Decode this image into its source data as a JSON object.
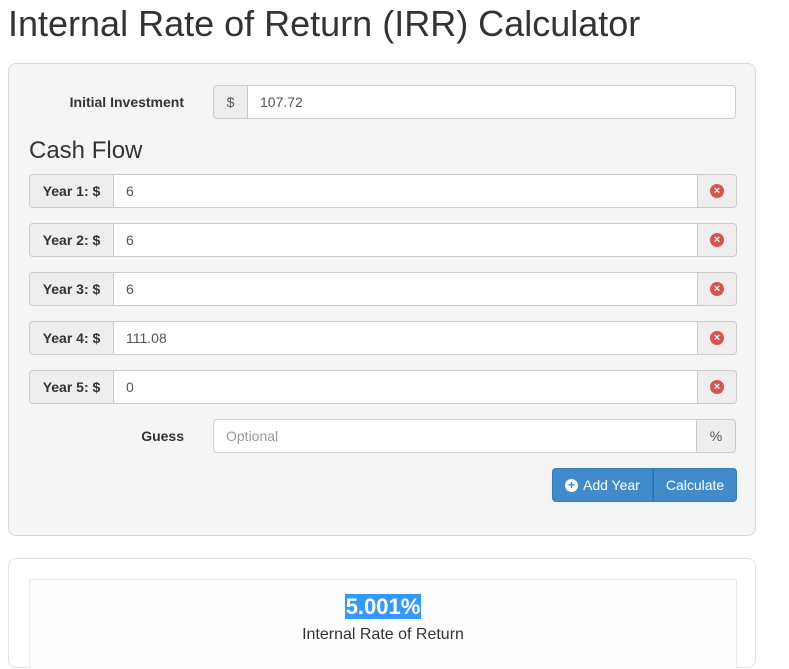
{
  "page": {
    "title": "Internal Rate of Return (IRR) Calculator"
  },
  "form": {
    "initial_investment": {
      "label": "Initial Investment",
      "prefix": "$",
      "value": "107.72"
    },
    "cash_flow_heading": "Cash Flow",
    "cash_flows": [
      {
        "label": "Year 1: $",
        "value": "6"
      },
      {
        "label": "Year 2: $",
        "value": "6"
      },
      {
        "label": "Year 3: $",
        "value": "6"
      },
      {
        "label": "Year 4: $",
        "value": "111.08"
      },
      {
        "label": "Year 5: $",
        "value": "0"
      }
    ],
    "remove_icon_name": "remove-circle-icon",
    "remove_icon_glyph": "×",
    "guess": {
      "label": "Guess",
      "placeholder": "Optional",
      "suffix": "%"
    },
    "add_year_icon_glyph": "+",
    "add_year_label": "Add Year",
    "calculate_label": "Calculate"
  },
  "result": {
    "value": "5.001%",
    "caption": "Internal Rate of Return"
  },
  "colors": {
    "primary": "#428bca",
    "danger": "#d9534f",
    "highlight": "#3399ff",
    "panel_background": "#f5f5f5"
  }
}
